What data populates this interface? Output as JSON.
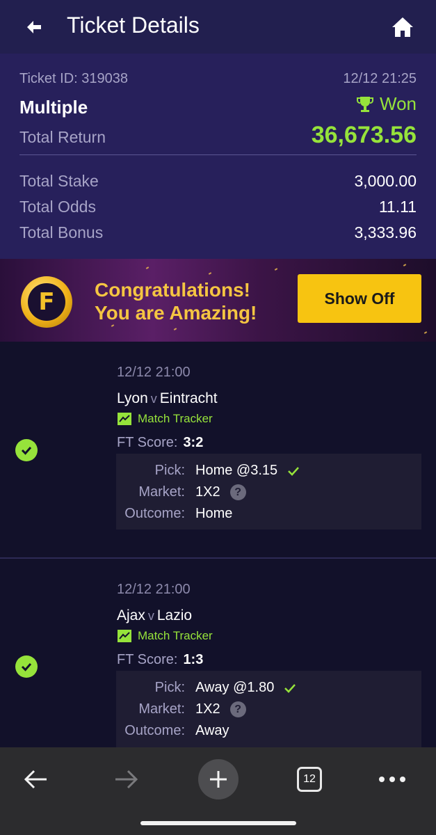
{
  "header": {
    "title": "Ticket Details",
    "back_icon": "back-arrow-icon",
    "home_icon": "home-icon"
  },
  "summary": {
    "ticket_id": "Ticket ID: 319038",
    "datetime": "12/12 21:25",
    "bet_type": "Multiple",
    "status": "Won",
    "total_return_label": "Total Return",
    "total_return": "36,673.56",
    "stats": [
      {
        "label": "Total Stake",
        "value": "3,000.00"
      },
      {
        "label": "Total Odds",
        "value": "11.11"
      },
      {
        "label": "Total Bonus",
        "value": "3,333.96"
      }
    ]
  },
  "banner": {
    "line1": "Congratulations!",
    "line2": "You are Amazing!",
    "button": "Show Off"
  },
  "selections": [
    {
      "date": "12/12 21:00",
      "home": "Lyon",
      "vs": "v",
      "away": "Eintracht",
      "tracker": "Match Tracker",
      "ft_label": "FT Score:",
      "ft_score": "3:2",
      "pick_label": "Pick:",
      "pick": "Home @3.15",
      "market_label": "Market:",
      "market": "1X2",
      "outcome_label": "Outcome:",
      "outcome": "Home"
    },
    {
      "date": "12/12 21:00",
      "home": "Ajax",
      "vs": "v",
      "away": "Lazio",
      "tracker": "Match Tracker",
      "ft_label": "FT Score:",
      "ft_score": "1:3",
      "pick_label": "Pick:",
      "pick": "Away @1.80",
      "market_label": "Market:",
      "market": "1X2",
      "outcome_label": "Outcome:",
      "outcome": "Away"
    }
  ],
  "navbar": {
    "tab_count": "12"
  },
  "colors": {
    "accent_green": "#96e33b",
    "header_bg": "#221f4f",
    "summary_bg": "#27205b",
    "button_yellow": "#f7c411"
  }
}
